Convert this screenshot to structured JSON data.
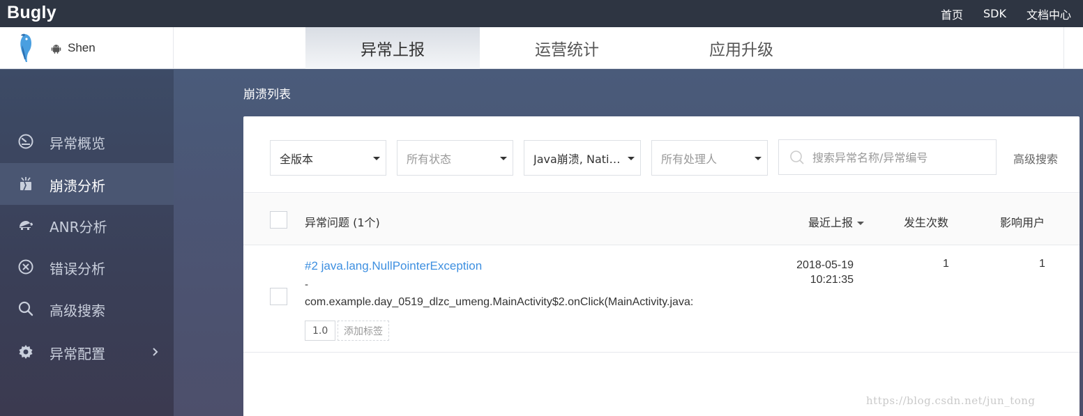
{
  "topbar": {
    "brand": "Bugly",
    "links": [
      "首页",
      "SDK",
      "文档中心"
    ]
  },
  "app": {
    "name": "Shen"
  },
  "tabs": [
    "异常上报",
    "运营统计",
    "应用升级"
  ],
  "sidebar": {
    "items": [
      {
        "label": "异常概览",
        "icon": "dashboard-icon"
      },
      {
        "label": "崩溃分析",
        "icon": "crash-icon"
      },
      {
        "label": "ANR分析",
        "icon": "turtle-icon"
      },
      {
        "label": "错误分析",
        "icon": "error-circle-icon"
      },
      {
        "label": "高级搜索",
        "icon": "search-icon"
      },
      {
        "label": "异常配置",
        "icon": "gear-icon"
      }
    ]
  },
  "page": {
    "title": "崩溃列表"
  },
  "filters": {
    "version": "全版本",
    "status": "所有状态",
    "type": "Java崩溃, Native崩溃",
    "assignee": "所有处理人",
    "search_placeholder": "搜索异常名称/异常编号",
    "advanced": "高级搜索"
  },
  "table": {
    "headers": {
      "issue": "异常问题 (1个)",
      "last_report": "最近上报",
      "occurrences": "发生次数",
      "affected_users": "影响用户"
    },
    "rows": [
      {
        "title": "#2 java.lang.NullPointerException",
        "dash": "-",
        "stack": "com.example.day_0519_dlzc_umeng.MainActivity$2.onClick(MainActivity.java:",
        "version_tag": "1.0",
        "add_tag": "添加标签",
        "date": "2018-05-19",
        "time": "10:21:35",
        "occurrences": "1",
        "users": "1"
      }
    ]
  },
  "watermark": "https://blog.csdn.net/jun_tong"
}
